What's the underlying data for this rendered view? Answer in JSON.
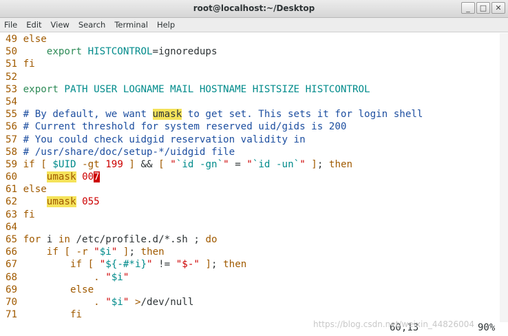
{
  "window": {
    "title": "root@localhost:~/Desktop",
    "minimize": "_",
    "maximize": "□",
    "close": "✕"
  },
  "menu": [
    "File",
    "Edit",
    "View",
    "Search",
    "Terminal",
    "Help"
  ],
  "lines": [
    {
      "n": "49",
      "parts": [
        [
          "kw",
          "else"
        ]
      ]
    },
    {
      "n": "50",
      "parts": [
        [
          "",
          "    "
        ],
        [
          "ty",
          "export"
        ],
        [
          "",
          ""
        ],
        [
          "va",
          " HISTCONTROL"
        ],
        [
          "",
          "=ignoredups"
        ]
      ]
    },
    {
      "n": "51",
      "parts": [
        [
          "kw",
          "fi"
        ]
      ]
    },
    {
      "n": "52",
      "parts": []
    },
    {
      "n": "53",
      "parts": [
        [
          "ty",
          "export"
        ],
        [
          "va",
          " PATH USER LOGNAME MAIL HOSTNAME HISTSIZE HISTCONTROL"
        ]
      ]
    },
    {
      "n": "54",
      "parts": []
    },
    {
      "n": "55",
      "parts": [
        [
          "cm",
          "# By default, we want "
        ],
        [
          "hl",
          "umask"
        ],
        [
          "cm",
          " to get set. This sets it for login shell"
        ]
      ]
    },
    {
      "n": "56",
      "parts": [
        [
          "cm",
          "# Current threshold for system reserved uid/gids is 200"
        ]
      ]
    },
    {
      "n": "57",
      "parts": [
        [
          "cm",
          "# You could check uidgid reservation validity in"
        ]
      ]
    },
    {
      "n": "58",
      "parts": [
        [
          "cm",
          "# /usr/share/doc/setup-*/uidgid file"
        ]
      ]
    },
    {
      "n": "59",
      "parts": [
        [
          "kw",
          "if"
        ],
        [
          "",
          " "
        ],
        [
          "kw",
          "["
        ],
        [
          "",
          " "
        ],
        [
          "va",
          "$UID"
        ],
        [
          "",
          " "
        ],
        [
          "kw",
          "-gt"
        ],
        [
          "",
          " "
        ],
        [
          "st",
          "199"
        ],
        [
          "",
          " "
        ],
        [
          "kw",
          "]"
        ],
        [
          "",
          " && "
        ],
        [
          "kw",
          "["
        ],
        [
          "",
          " "
        ],
        [
          "st",
          "\""
        ],
        [
          "va",
          "`id -gn`"
        ],
        [
          "st",
          "\""
        ],
        [
          "",
          " = "
        ],
        [
          "st",
          "\""
        ],
        [
          "va",
          "`id -un`"
        ],
        [
          "st",
          "\""
        ],
        [
          "",
          " "
        ],
        [
          "kw",
          "]"
        ],
        [
          "",
          "; "
        ],
        [
          "kw",
          "then"
        ]
      ]
    },
    {
      "n": "60",
      "parts": [
        [
          "",
          "    "
        ],
        [
          "hlk",
          "umask"
        ],
        [
          "",
          " "
        ],
        [
          "st",
          "00"
        ],
        [
          "cur",
          "7"
        ]
      ]
    },
    {
      "n": "61",
      "parts": [
        [
          "kw",
          "else"
        ]
      ]
    },
    {
      "n": "62",
      "parts": [
        [
          "",
          "    "
        ],
        [
          "hlk",
          "umask"
        ],
        [
          "",
          " "
        ],
        [
          "st",
          "055"
        ]
      ]
    },
    {
      "n": "63",
      "parts": [
        [
          "kw",
          "fi"
        ]
      ]
    },
    {
      "n": "64",
      "parts": []
    },
    {
      "n": "65",
      "parts": [
        [
          "kw",
          "for"
        ],
        [
          "",
          " i "
        ],
        [
          "kw",
          "in"
        ],
        [
          "",
          " /etc/profile.d/*.sh ; "
        ],
        [
          "kw",
          "do"
        ]
      ]
    },
    {
      "n": "66",
      "parts": [
        [
          "",
          "    "
        ],
        [
          "kw",
          "if"
        ],
        [
          "",
          " "
        ],
        [
          "kw",
          "["
        ],
        [
          "",
          " "
        ],
        [
          "kw",
          "-r"
        ],
        [
          "",
          " "
        ],
        [
          "st",
          "\""
        ],
        [
          "va",
          "$i"
        ],
        [
          "st",
          "\""
        ],
        [
          "",
          " "
        ],
        [
          "kw",
          "]"
        ],
        [
          "",
          "; "
        ],
        [
          "kw",
          "then"
        ]
      ]
    },
    {
      "n": "67",
      "parts": [
        [
          "",
          "        "
        ],
        [
          "kw",
          "if"
        ],
        [
          "",
          " "
        ],
        [
          "kw",
          "["
        ],
        [
          "",
          " "
        ],
        [
          "st",
          "\""
        ],
        [
          "va",
          "${-#*i}"
        ],
        [
          "st",
          "\""
        ],
        [
          "",
          " != "
        ],
        [
          "st",
          "\"$-\""
        ],
        [
          "",
          " "
        ],
        [
          "kw",
          "]"
        ],
        [
          "",
          "; "
        ],
        [
          "kw",
          "then"
        ]
      ]
    },
    {
      "n": "68",
      "parts": [
        [
          "",
          "            "
        ],
        [
          "kw",
          "."
        ],
        [
          "",
          " "
        ],
        [
          "st",
          "\""
        ],
        [
          "va",
          "$i"
        ],
        [
          "st",
          "\""
        ]
      ]
    },
    {
      "n": "69",
      "parts": [
        [
          "",
          "        "
        ],
        [
          "kw",
          "else"
        ]
      ]
    },
    {
      "n": "70",
      "parts": [
        [
          "",
          "            "
        ],
        [
          "kw",
          "."
        ],
        [
          "",
          " "
        ],
        [
          "st",
          "\""
        ],
        [
          "va",
          "$i"
        ],
        [
          "st",
          "\""
        ],
        [
          "",
          " "
        ],
        [
          "kw",
          ">"
        ],
        [
          "",
          "/dev/null"
        ]
      ]
    },
    {
      "n": "71",
      "parts": [
        [
          "",
          "        "
        ],
        [
          "kw",
          "fi"
        ]
      ]
    }
  ],
  "status": {
    "position": "60,13",
    "percent": "90%"
  },
  "watermark": "https://blog.csdn.net/weixin_44826004"
}
